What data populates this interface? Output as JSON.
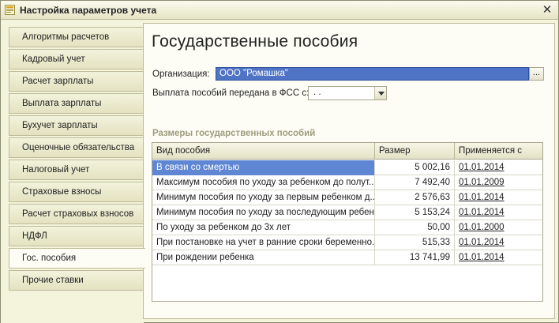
{
  "window": {
    "title": "Настройка параметров учета",
    "close_label": "✕"
  },
  "tabs": [
    {
      "label": "Алгоритмы расчетов",
      "active": false
    },
    {
      "label": "Кадровый учет",
      "active": false
    },
    {
      "label": "Расчет зарплаты",
      "active": false
    },
    {
      "label": "Выплата зарплаты",
      "active": false
    },
    {
      "label": "Бухучет зарплаты",
      "active": false
    },
    {
      "label": "Оценочные обязательства",
      "active": false
    },
    {
      "label": "Налоговый учет",
      "active": false
    },
    {
      "label": "Страховые взносы",
      "active": false
    },
    {
      "label": "Расчет страховых взносов",
      "active": false
    },
    {
      "label": "НДФЛ",
      "active": false
    },
    {
      "label": "Гос. пособия",
      "active": true
    },
    {
      "label": "Прочие ставки",
      "active": false
    }
  ],
  "page": {
    "title": "Государственные пособия",
    "organization_label": "Организация:",
    "organization_value": "ООО \"Ромашка\"",
    "select_button": "...",
    "fss_label": "Выплата пособий передана в ФСС с:",
    "fss_date": " .  ."
  },
  "benefits": {
    "section_title": "Размеры государственных пособий",
    "columns": [
      "Вид пособия",
      "Размер",
      "Применяется с"
    ],
    "rows": [
      {
        "name": "В связи со смертью",
        "amount": "5 002,16",
        "date": "01.01.2014",
        "selected": true
      },
      {
        "name": "Максимум пособия по уходу за ребенком до полут...",
        "amount": "7 492,40",
        "date": "01.01.2009",
        "selected": false
      },
      {
        "name": "Минимум пособия по уходу за первым ребенком д...",
        "amount": "2 576,63",
        "date": "01.01.2014",
        "selected": false
      },
      {
        "name": "Минимум пособия по уходу за последующим ребен...",
        "amount": "5 153,24",
        "date": "01.01.2014",
        "selected": false
      },
      {
        "name": "По уходу за ребенком до 3х лет",
        "amount": "50,00",
        "date": "01.01.2000",
        "selected": false
      },
      {
        "name": "При постановке на учет в ранние сроки беременно...",
        "amount": "515,33",
        "date": "01.01.2014",
        "selected": false
      },
      {
        "name": "При рождении ребенка",
        "amount": "13 741,99",
        "date": "01.01.2014",
        "selected": false
      }
    ]
  },
  "colors": {
    "background": "#f4f3dc",
    "selection": "#5f86d2",
    "section_title": "#9e9c7e"
  }
}
